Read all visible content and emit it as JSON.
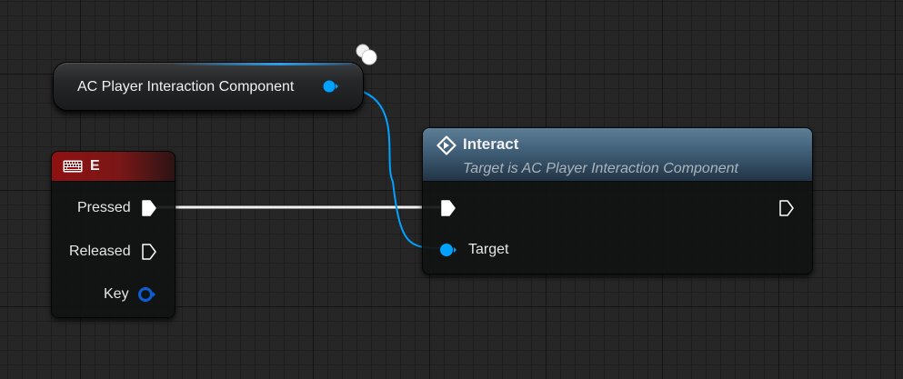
{
  "graph": {
    "variable_node": {
      "label": "AC Player Interaction Component",
      "pin_color": "#00a2ff"
    },
    "key_event_node": {
      "title": "E",
      "header_color": "#8f1111",
      "icon": "keyboard-icon",
      "pins": {
        "pressed": "Pressed",
        "released": "Released",
        "key": "Key"
      }
    },
    "function_node": {
      "title": "Interact",
      "subtitle": "Target is AC Player Interaction Component",
      "icon": "function-icon",
      "pins": {
        "target": "Target"
      }
    },
    "colors": {
      "exec_wire": "#ffffff",
      "object_wire": "#00a2ff",
      "struct_pin": "#0a5fd6"
    }
  }
}
